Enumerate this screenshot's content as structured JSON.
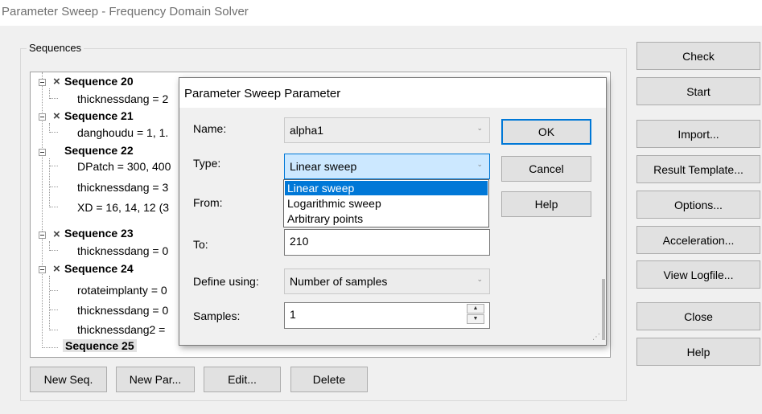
{
  "window": {
    "title": "Parameter Sweep - Frequency Domain Solver"
  },
  "sequences": {
    "caption": "Sequences",
    "tree": [
      {
        "label": "Sequence 20",
        "params": [
          "thicknessdang = 2"
        ]
      },
      {
        "label": "Sequence 21",
        "params": [
          "danghoudu = 1, 1."
        ]
      },
      {
        "label": "Sequence 22",
        "params": [
          "DPatch = 300, 400",
          "thicknessdang = 3",
          "XD = 16, 14, 12 (3"
        ]
      },
      {
        "label": "Sequence 23",
        "params": [
          "thicknessdang = 0"
        ]
      },
      {
        "label": "Sequence 24",
        "params": [
          "rotateimplanty = 0",
          "thicknessdang = 0",
          "thicknessdang2 ="
        ]
      },
      {
        "label": "Sequence 25",
        "params": []
      }
    ],
    "buttons": {
      "new_seq": "New Seq.",
      "new_par": "New Par...",
      "edit": "Edit...",
      "delete": "Delete"
    }
  },
  "side_buttons": {
    "check": "Check",
    "start": "Start",
    "import": "Import...",
    "result_template": "Result Template...",
    "options": "Options...",
    "acceleration": "Acceleration...",
    "view_logfile": "View Logfile...",
    "close": "Close",
    "help": "Help"
  },
  "dialog": {
    "title": "Parameter Sweep Parameter",
    "name_label": "Name:",
    "name_value": "alpha1",
    "type_label": "Type:",
    "type_value": "Linear sweep",
    "type_options": [
      "Linear sweep",
      "Logarithmic sweep",
      "Arbitrary points"
    ],
    "from_label": "From:",
    "to_label": "To:",
    "to_value": "210",
    "define_label": "Define using:",
    "define_value": "Number of samples",
    "samples_label": "Samples:",
    "samples_value": "1",
    "ok": "OK",
    "cancel": "Cancel",
    "help": "Help"
  }
}
